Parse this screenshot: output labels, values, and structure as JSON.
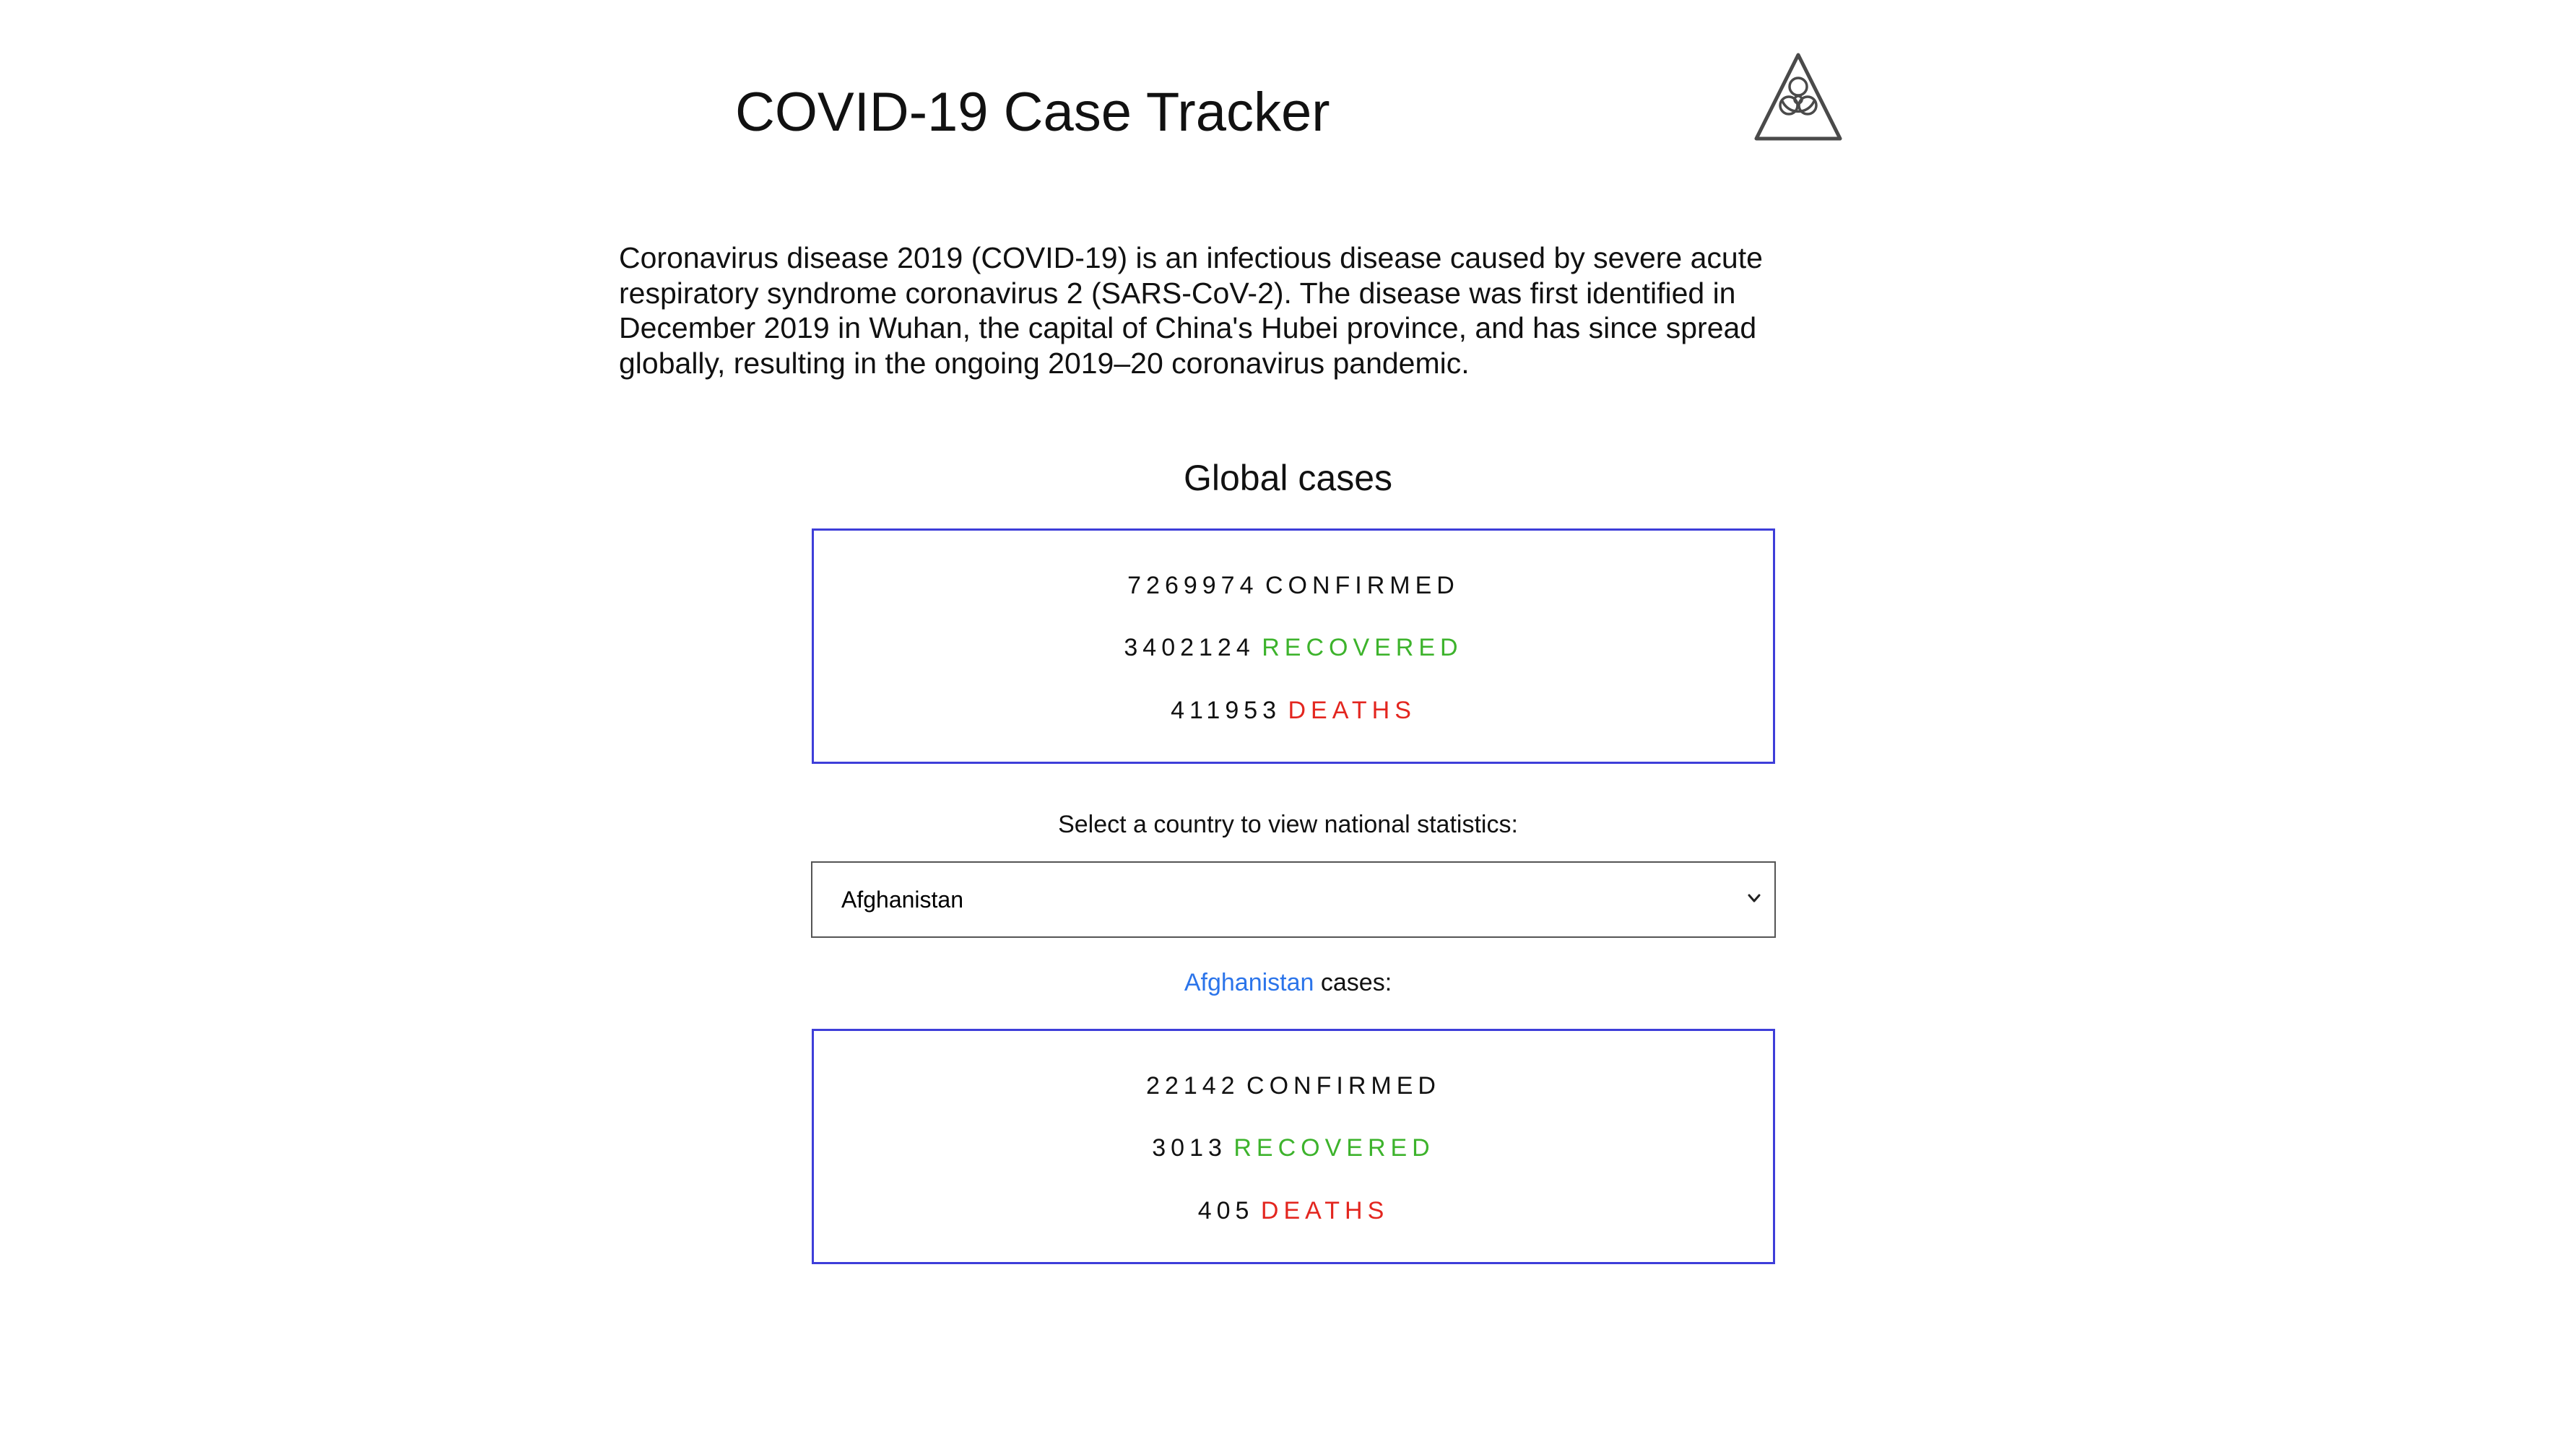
{
  "header": {
    "title": "COVID-19 Case Tracker",
    "logo_icon": "biohazard-icon"
  },
  "intro": {
    "text": "Coronavirus disease 2019 (COVID-19) is an infectious disease caused by severe acute respiratory syndrome coronavirus 2 (SARS-CoV-2). The disease was first identified in December 2019 in Wuhan, the capital of China's Hubei province, and has since spread globally, resulting in the ongoing 2019–20 coronavirus pandemic."
  },
  "global": {
    "title": "Global cases",
    "confirmed": "7269974",
    "confirmed_label": "CONFIRMED",
    "recovered": "3402124",
    "recovered_label": "RECOVERED",
    "deaths": "411953",
    "deaths_label": "DEATHS"
  },
  "country_select": {
    "prompt": "Select a country to view national statistics:",
    "selected": "Afghanistan",
    "chevron_icon": "chevron-down-icon"
  },
  "national": {
    "country": "Afghanistan",
    "caption_suffix": "cases:",
    "confirmed": "22142",
    "confirmed_label": "CONFIRMED",
    "recovered": "3013",
    "recovered_label": "RECOVERED",
    "deaths": "405",
    "deaths_label": "DEATHS"
  },
  "colors": {
    "box_border": "#3e3ed9",
    "recovered": "#3db32c",
    "deaths": "#e3261f",
    "link": "#2b74ea"
  }
}
